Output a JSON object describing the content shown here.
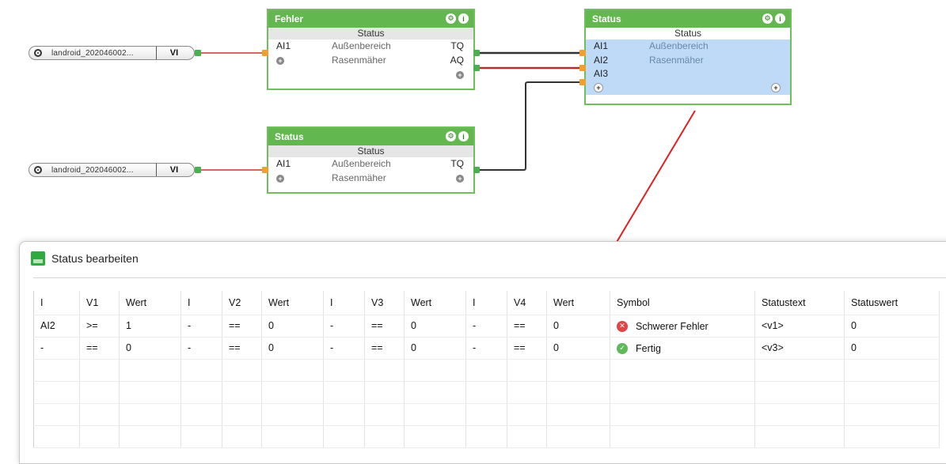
{
  "inputs": [
    {
      "name": "landroid_202046002...",
      "tag": "VI"
    },
    {
      "name": "landroid_202046002...",
      "tag": "VI"
    }
  ],
  "blocks": {
    "fehler": {
      "title": "Fehler",
      "subtitle": "Status",
      "rows": [
        {
          "left": "AI1",
          "mid": "Außenbereich",
          "right": "TQ"
        },
        {
          "left": "",
          "mid": "Rasenmäher",
          "right": "AQ"
        }
      ]
    },
    "status_small": {
      "title": "Status",
      "subtitle": "Status",
      "rows": [
        {
          "left": "AI1",
          "mid": "Außenbereich",
          "right": "TQ"
        },
        {
          "left": "",
          "mid": "Rasenmäher",
          "right": ""
        }
      ]
    },
    "status_main": {
      "title": "Status",
      "subtitle": "Status",
      "rows": [
        {
          "left": "AI1",
          "mid": "Außenbereich"
        },
        {
          "left": "AI2",
          "mid": "Rasenmäher"
        },
        {
          "left": "AI3",
          "mid": ""
        }
      ]
    }
  },
  "dialog": {
    "title": "Status bearbeiten",
    "columns": [
      "I",
      "V1",
      "Wert",
      "I",
      "V2",
      "Wert",
      "I",
      "V3",
      "Wert",
      "I",
      "V4",
      "Wert",
      "Symbol",
      "Statustext",
      "Statuswert"
    ],
    "rows": [
      {
        "i1": "AI2",
        "v1": ">=",
        "w1": "1",
        "i2": "-",
        "v2": "==",
        "w2": "0",
        "i3": "-",
        "v3": "==",
        "w3": "0",
        "i4": "-",
        "v4": "==",
        "w4": "0",
        "symbol": "Schwerer Fehler",
        "symbol_icon": "error-icon",
        "statustext": "<v1>",
        "statuswert": "0"
      },
      {
        "i1": "-",
        "v1": "==",
        "w1": "0",
        "i2": "-",
        "v2": "==",
        "w2": "0",
        "i3": "-",
        "v3": "==",
        "w3": "0",
        "i4": "-",
        "v4": "==",
        "w4": "0",
        "symbol": "Fertig",
        "symbol_icon": "check-icon",
        "statustext": "<v3>",
        "statuswert": "0"
      }
    ]
  },
  "colors": {
    "block_header": "#62b84e",
    "selection": "#bfdaf7",
    "wire_red": "#c0392b",
    "wire_dark": "#333333",
    "arrow": "#e02020"
  }
}
